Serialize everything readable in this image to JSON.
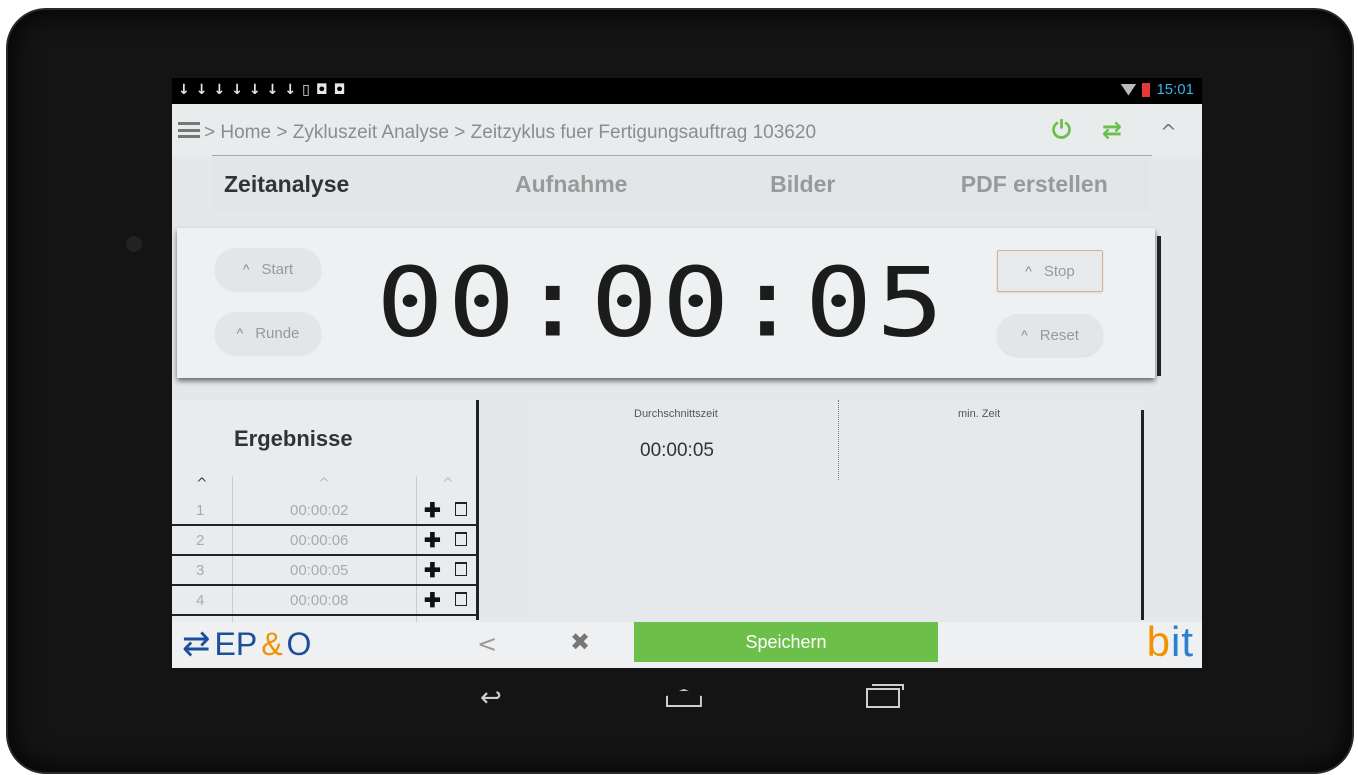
{
  "status_bar": {
    "download_icons": [
      "↓",
      "↓",
      "↓",
      "↓",
      "↓",
      "↓",
      "↓",
      "▯",
      "◘",
      "◘"
    ],
    "time": "15:01"
  },
  "nav": {
    "breadcrumb": "> Home > Zykluszeit Analyse > Zeitzyklus fuer Fertigungsauftrag 103620",
    "power_glyph": "⏻",
    "sync_glyph": "⇄",
    "collapse_glyph": "^"
  },
  "tabs": [
    {
      "label": "Zeitanalyse",
      "active": true
    },
    {
      "label": "Aufnahme",
      "active": false
    },
    {
      "label": "Bilder",
      "active": false
    },
    {
      "label": "PDF erstellen",
      "active": false
    }
  ],
  "timer": {
    "display": "00:00:05",
    "start_label": "Start",
    "round_label": "Runde",
    "stop_label": "Stop",
    "reset_label": "Reset",
    "caret": "^"
  },
  "results": {
    "title": "Ergebnisse",
    "sort_caret": "^",
    "rows": [
      {
        "index": "1",
        "time": "00:00:02"
      },
      {
        "index": "2",
        "time": "00:00:06"
      },
      {
        "index": "3",
        "time": "00:00:05"
      },
      {
        "index": "4",
        "time": "00:00:08"
      }
    ],
    "add_glyph": "✚"
  },
  "stats": {
    "avg_label": "Durchschnittszeit",
    "avg_value": "00:00:05",
    "min_label": "min. Zeit"
  },
  "bottom": {
    "logo_left_a": "EP",
    "logo_left_amp": "&",
    "logo_left_b": "O",
    "back_glyph": "<",
    "close_glyph": "✖",
    "save_label": "Speichern",
    "logo_right_b": "b",
    "logo_right_rest": "it"
  },
  "colors": {
    "accent_green": "#6cc04a",
    "clock_blue": "#33b5e5",
    "logo_blue": "#1a4f9c",
    "logo_orange": "#f39200"
  }
}
